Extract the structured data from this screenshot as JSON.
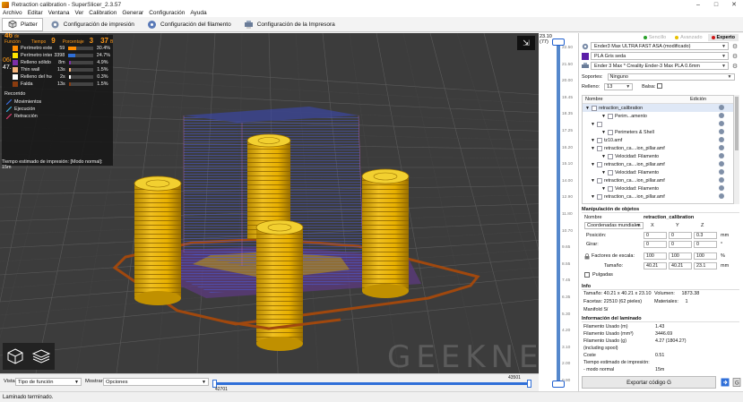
{
  "window": {
    "title": "Retraction calibration - SuperSlicer_2.3.57"
  },
  "menu": [
    "Archivo",
    "Editar",
    "Ventana",
    "Ver",
    "Calibration",
    "Generar",
    "Configuración",
    "Ayuda"
  ],
  "tabs": [
    {
      "label": "Platter",
      "icon": "cube-icon"
    },
    {
      "label": "Configuración de impresión",
      "icon": "gear-icon"
    },
    {
      "label": "Configuración del filamento",
      "icon": "filament-icon"
    },
    {
      "label": "Configuración de la Impresora",
      "icon": "printer-icon"
    }
  ],
  "legend": {
    "header": {
      "c1_num": "46",
      "c1_txt": "de Función",
      "c2_num": "9",
      "c2_txt": "Tiempo",
      "c3_txt": "Porcentaje",
      "c4_num": "3",
      "c5_num": "37",
      "c5_txt": "B"
    },
    "rows": [
      {
        "name": "Perímetro externo",
        "time": "59",
        "pct": "30.4%",
        "color": "#ff8c00",
        "bar": "#ff8c00",
        "fill": 0.3
      },
      {
        "name": "Perímetro interno",
        "time": "3398",
        "pct": "24.7%",
        "color": "#ffe600",
        "bar": "#2f6fd8",
        "fill": 0.25
      },
      {
        "name": "Relleno sólido",
        "time": "8m",
        "pct": "4.9%",
        "color": "#7d2ea8",
        "bar": "#7d2ea8",
        "fill": 0.05
      },
      {
        "name": "Thin wall",
        "time": "13s",
        "pct": "1.5%",
        "color": "#f3b27a",
        "bar": "#f3b27a",
        "fill": 0.02
      },
      {
        "name": "Relleno del hueco",
        "time": "2s",
        "pct": "0.3%",
        "color": "#ffffff",
        "bar": "#ffffff",
        "fill": 0.01
      },
      {
        "name": "Falda",
        "time": "13s",
        "pct": "1.5%",
        "color": "#8a3c0f",
        "bar": "#8a3c0f",
        "fill": 0.02
      }
    ],
    "left_nums": [
      "06i",
      "47.",
      "1"
    ],
    "travel_header": "Recorrido",
    "travel": [
      {
        "label": "Movimientos",
        "color": "#3a6ad4"
      },
      {
        "label": "Ejecución",
        "color": "#3aa6d4"
      },
      {
        "label": "Retracción",
        "color": "#d43a6a"
      }
    ],
    "time_estimate": "Tiempo estimado de impresión: [Modo normal]:  15m"
  },
  "layer_slider": {
    "top_value": "23.10",
    "top_layer": "(77)",
    "ticks": [
      "22.50",
      "21.50",
      "20.00",
      "19.45",
      "18.35",
      "17.25",
      "16.20",
      "15.10",
      "14.00",
      "12.90",
      "11.80",
      "10.70",
      "9.65",
      "8.55",
      "7.45",
      "6.35",
      "5.30",
      "4.20",
      "3.10",
      "2.00",
      "0.90"
    ]
  },
  "modes": [
    {
      "label": "Sencillo",
      "color": "#2aa02a",
      "active": false
    },
    {
      "label": "Avanzado",
      "color": "#e8c000",
      "active": false
    },
    {
      "label": "Experto",
      "color": "#d01818",
      "active": true
    }
  ],
  "presets": {
    "print": "Ender3 Max ULTRA FAST ASA (modificado)",
    "filament": "PLA Gris seda",
    "printer": "Ender 3 Max * Creality Ender-3 Max PLA 0.6mm"
  },
  "support": {
    "label": "Soportes:",
    "value": "Ninguno"
  },
  "infill": {
    "label": "Relleno:",
    "value": "13",
    "brim_label": "Balsa:"
  },
  "object_list": {
    "col_name": "Nombre",
    "col_edit": "Edición",
    "rows": [
      {
        "text": "retraction_calibration",
        "indent": 0,
        "selected": true
      },
      {
        "text": "Perim...amento",
        "indent": 3,
        "selected": false
      },
      {
        "text": "",
        "indent": 1,
        "selected": false
      },
      {
        "text": "Perimeters & Shell",
        "indent": 3,
        "selected": false
      },
      {
        "text": "tz10.amf",
        "indent": 1,
        "selected": false
      },
      {
        "text": "retraction_ca....ion_pillar.amf",
        "indent": 1,
        "selected": false
      },
      {
        "text": "Velocidad: Filamento",
        "indent": 3,
        "selected": false
      },
      {
        "text": "retraction_ca....ion_pillar.amf",
        "indent": 1,
        "selected": false
      },
      {
        "text": "Velocidad: Filamento",
        "indent": 3,
        "selected": false
      },
      {
        "text": "retraction_ca....ion_pillar.amf",
        "indent": 1,
        "selected": false
      },
      {
        "text": "Velocidad: Filamento",
        "indent": 3,
        "selected": false
      },
      {
        "text": "retraction_ca....ion_pillar.amf",
        "indent": 1,
        "selected": false
      }
    ]
  },
  "manip": {
    "title": "Manipulación de objetos",
    "name_label": "Nombre",
    "name_value": "retraction_calibration",
    "coords": "Coordenadas mundiales",
    "axes": [
      "X",
      "Y",
      "Z"
    ],
    "position_label": "Posición:",
    "position": [
      "0",
      "0",
      "0.3"
    ],
    "rotate_label": "Girar:",
    "rotate": [
      "0",
      "0",
      "0"
    ],
    "scale_label": "Factores de escala:",
    "scale": [
      "100",
      "100",
      "100"
    ],
    "size_label": "Tamaño:",
    "size": [
      "40.21",
      "40.21",
      "23.1"
    ],
    "units": [
      "mm",
      "°",
      "%",
      "mm"
    ],
    "inches_label": "Pulgadas"
  },
  "info": {
    "title": "Info",
    "size_label": "Tamaño:",
    "size_value": "40.21 x 40.21 x 23.10",
    "volume_label": "Volumen:",
    "volume_value": "1873.38",
    "facets_label": "Facetas:",
    "facets_value": "22510 (62 pieles)",
    "materials_label": "Materiales:",
    "materials_value": "1",
    "manifold": "Manifold Sí"
  },
  "sliced": {
    "title": "Información del laminado",
    "rows": [
      {
        "label": "Filamento Usado (m)",
        "value": "1.43"
      },
      {
        "label": "Filamento Usado (mm³)",
        "value": "3446.69"
      },
      {
        "label": "Filamento Usado (g)",
        "value": "4.27 (1804.27)"
      },
      {
        "label": "(including spool)",
        "value": ""
      },
      {
        "label": "Coste",
        "value": "0.51"
      },
      {
        "label": "Tiempo estimado de impresión:",
        "value": ""
      },
      {
        "label": "- modo normal",
        "value": "15m"
      }
    ]
  },
  "export_label": "Exportar código G",
  "bottom": {
    "view_label": "Vista",
    "view_value": "Tipo de función",
    "show_label": "Mostrar",
    "show_value": "Opciones",
    "h_left": "42701",
    "h_right": "43501"
  },
  "status": "Laminado terminado.",
  "watermark": "GEEKNETIC"
}
